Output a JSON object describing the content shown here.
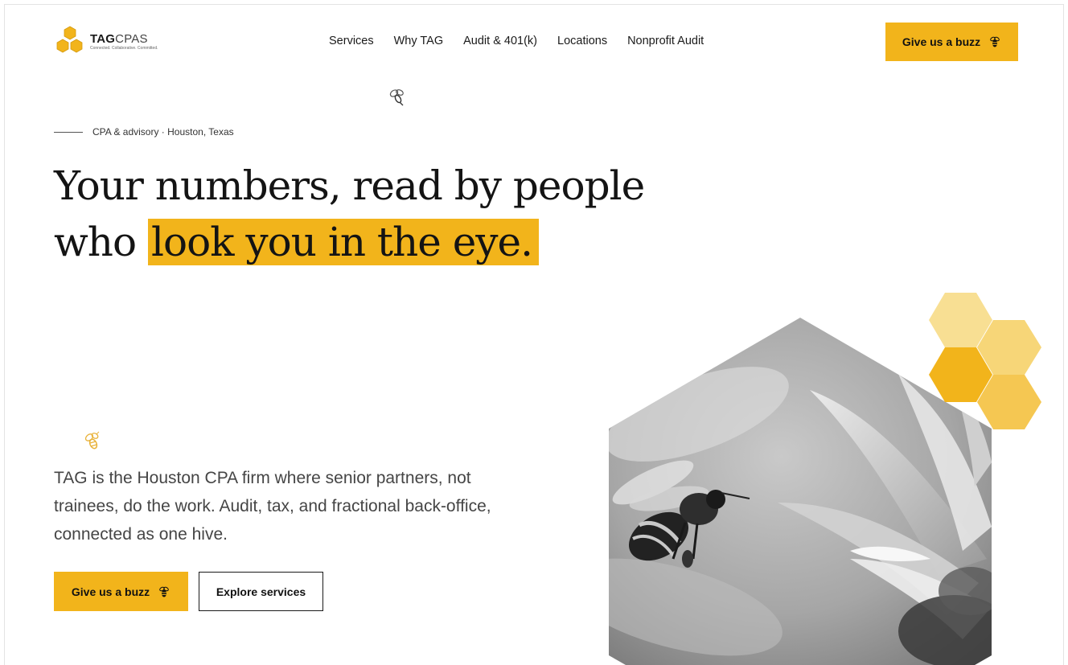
{
  "brand": {
    "name_bold": "TAG",
    "name_light": "CPAS",
    "tagline": "Connected. Collaborative. Committed.",
    "accent_color": "#f2b41b"
  },
  "nav": {
    "items": [
      {
        "label": "Services"
      },
      {
        "label": "Why TAG"
      },
      {
        "label": "Audit & 401(k)"
      },
      {
        "label": "Locations"
      },
      {
        "label": "Nonprofit Audit"
      }
    ],
    "cta_label": "Give us a buzz",
    "cta_icon": "bee-icon"
  },
  "hero": {
    "eyebrow": "CPA & advisory · Houston, Texas",
    "headline_line1": "Your numbers, read by people",
    "headline_line2_prefix": "who ",
    "headline_highlight": "look you in the eye.",
    "lead": "TAG is the Houston CPA firm where senior partners, not trainees, do the work. Audit, tax, and fractional back-office, connected as one hive.",
    "primary_button": "Give us a buzz",
    "secondary_button": "Explore services",
    "image_subject": "black-and-white bee approaching flower in hexagon frame"
  }
}
